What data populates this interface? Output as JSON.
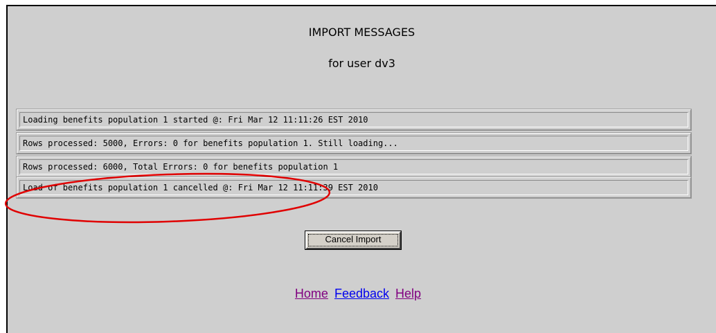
{
  "header": {
    "title": "IMPORT MESSAGES",
    "subtitle": "for user dv3"
  },
  "messages": [
    "Loading benefits population 1 started @: Fri Mar 12 11:11:26 EST 2010",
    "Rows processed: 5000, Errors: 0 for benefits population 1. Still loading...",
    "Rows processed: 6000, Total Errors: 0 for benefits population 1",
    "Load of benefits population 1 cancelled @: Fri Mar 12 11:11:39 EST 2010"
  ],
  "actions": {
    "cancel_label": "Cancel Import"
  },
  "footer_links": {
    "home": "Home",
    "feedback": "Feedback",
    "help": "Help"
  },
  "colors": {
    "panel_background": "#cfcfcf",
    "visited_link": "#800080",
    "link": "#0000ee",
    "annotation_ellipse": "#e00000"
  }
}
